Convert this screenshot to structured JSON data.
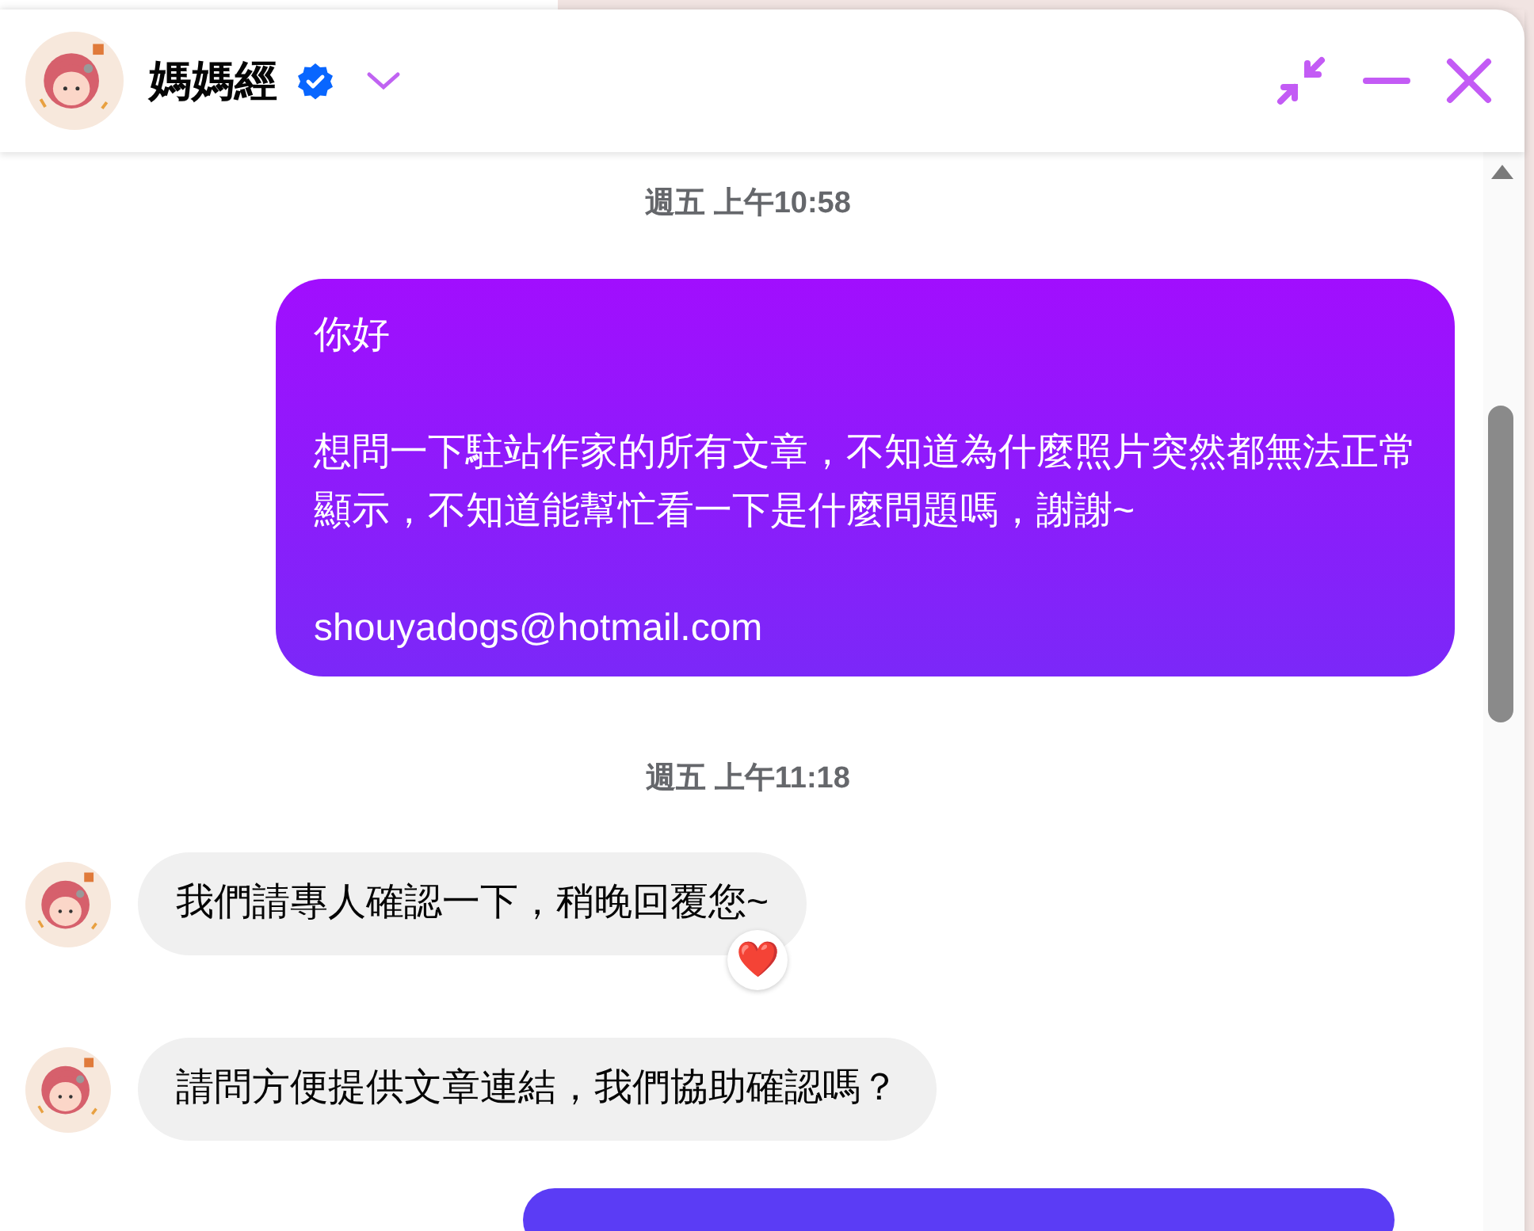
{
  "window": {
    "title": "媽媽經",
    "verified": true
  },
  "messages": [
    {
      "kind": "timestamp",
      "text": "週五 上午10:58"
    },
    {
      "kind": "outgoing",
      "paragraphs": [
        "你好",
        "想問一下駐站作家的所有文章，不知道為什麼照片突然都無法正常顯示，不知道能幫忙看一下是什麼問題嗎，謝謝~",
        "shouyadogs@hotmail.com"
      ]
    },
    {
      "kind": "timestamp",
      "text": "週五 上午11:18"
    },
    {
      "kind": "incoming",
      "paragraphs": [
        "我們請專人確認一下，稍晚回覆您~"
      ],
      "reaction": "❤️"
    },
    {
      "kind": "incoming",
      "paragraphs": [
        "請問方便提供文章連結，我們協助確認嗎？"
      ]
    },
    {
      "kind": "outgoing_partial"
    }
  ]
}
